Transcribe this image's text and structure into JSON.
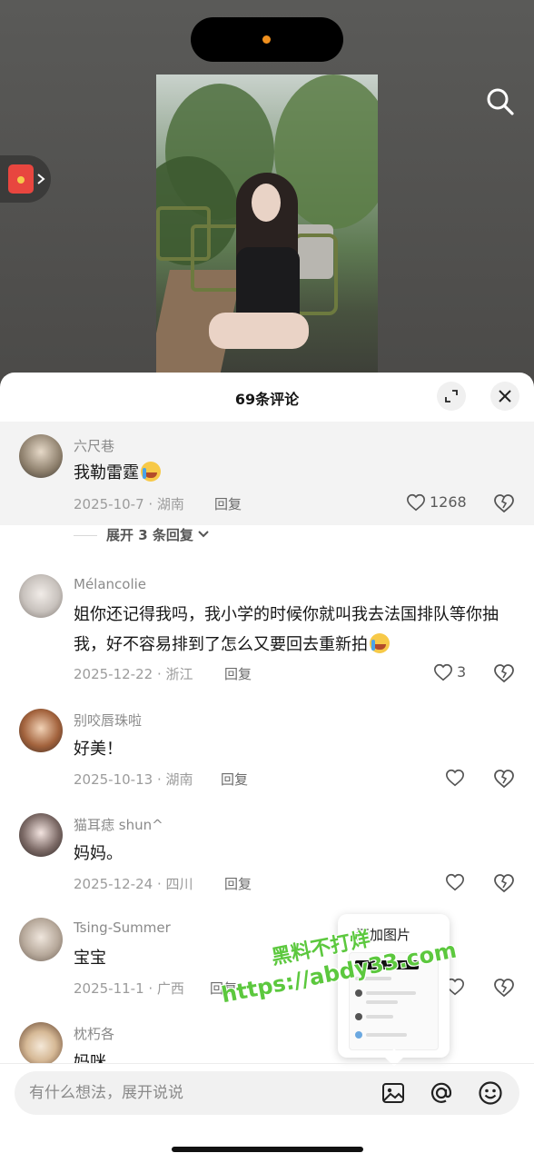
{
  "sheet": {
    "title": "69条评论",
    "expand_icon": "expand-icon",
    "close_icon": "close-icon"
  },
  "comments": [
    {
      "username": "六尺巷",
      "text": "我勒雷霆",
      "emoji": "crying-emoji",
      "date_location": "2025-10-7 · 湖南",
      "reply_label": "回复",
      "likes": "1268",
      "expand_replies": "展开 3 条回复"
    },
    {
      "username": "Mélancolie",
      "text": "姐你还记得我吗，我小学的时候你就叫我去法国排队等你抽我，好不容易排到了怎么又要回去重新拍",
      "emoji": "crying-emoji",
      "date_location": "2025-12-22 · 浙江",
      "reply_label": "回复",
      "likes": "3"
    },
    {
      "username": "别咬唇珠啦",
      "text": "好美！",
      "date_location": "2025-10-13 · 湖南",
      "reply_label": "回复",
      "likes": ""
    },
    {
      "username": "猫耳痣 shun^",
      "text": "妈妈。",
      "date_location": "2025-12-24 · 四川",
      "reply_label": "回复",
      "likes": ""
    },
    {
      "username": "Tsing-Summer",
      "text": "宝宝",
      "date_location": "2025-11-1 · 广西",
      "reply_label": "回复",
      "likes": ""
    },
    {
      "username": "枕朽各",
      "text": "妈咪",
      "date_location": "",
      "reply_label": "",
      "likes": ""
    }
  ],
  "popup": {
    "title": "添加图片"
  },
  "watermark": {
    "line1": "黑料不打烊",
    "line2": "https://abdy33.com"
  },
  "input": {
    "placeholder": "有什么想法，展开说说",
    "value": ""
  },
  "icons": {
    "search": "search-icon",
    "red_packet": "red-packet-icon",
    "image": "image-icon",
    "mention": "at-icon",
    "emoji": "emoji-icon",
    "like": "heart-icon",
    "dislike": "broken-heart-icon"
  },
  "colors": {
    "accent_orange": "#f0901e",
    "watermark_green": "#5cc83e",
    "red_packet": "#e8463f"
  }
}
